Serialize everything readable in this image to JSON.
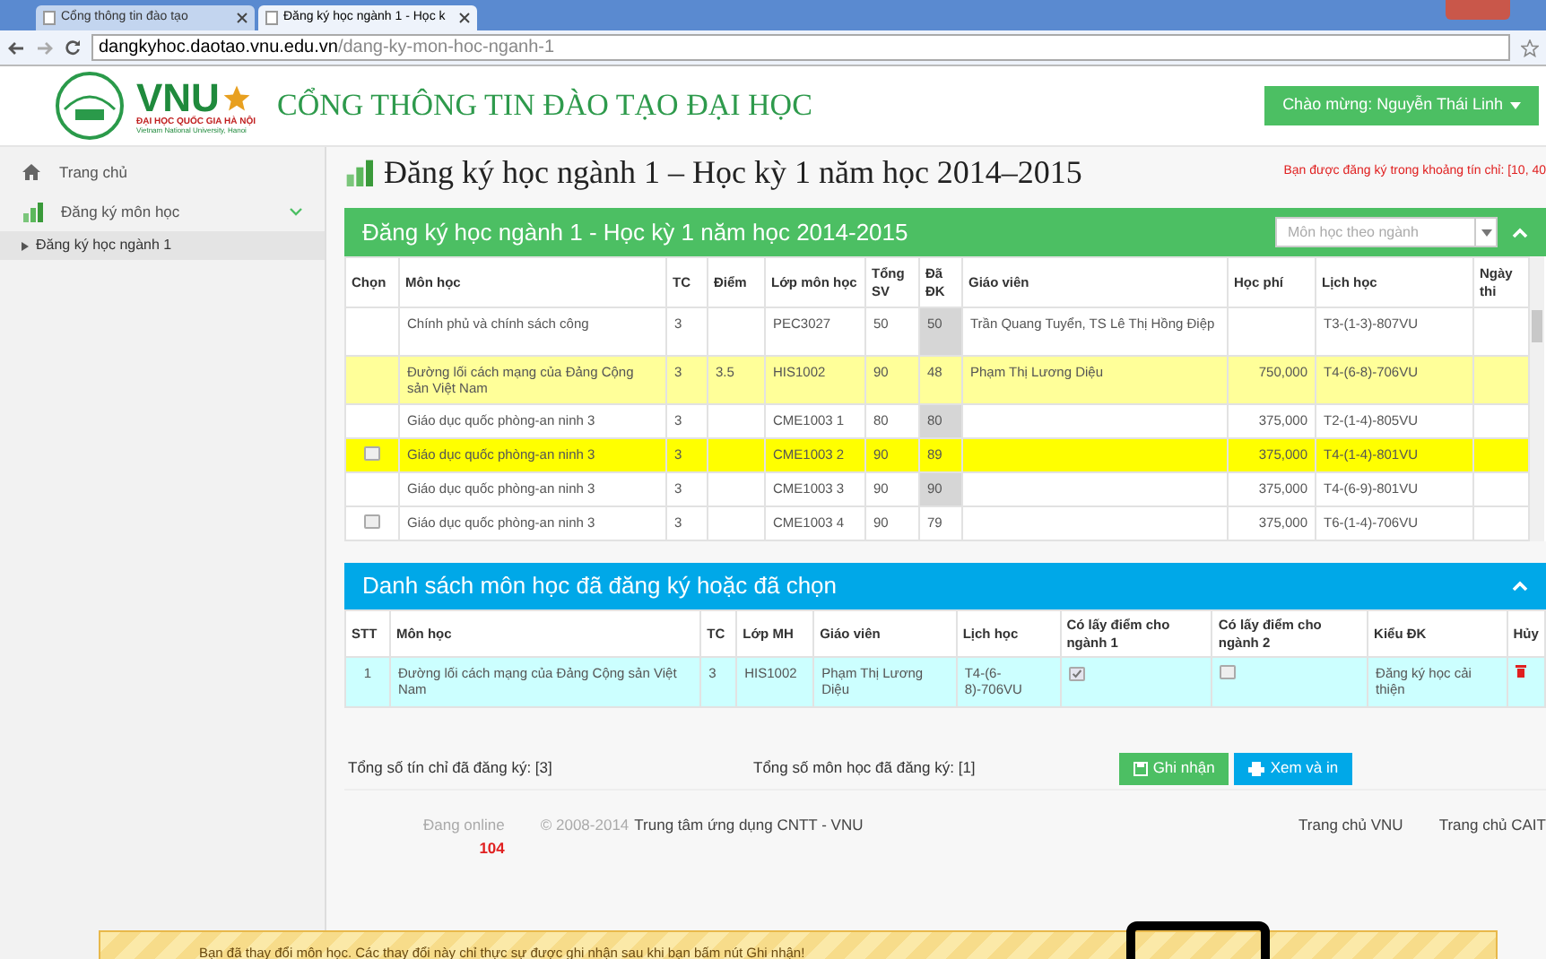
{
  "browser": {
    "tabs": [
      {
        "label": "Cổng thông tin đào tạo",
        "selected": false
      },
      {
        "label": "Đăng ký học ngành 1 - Học k",
        "selected": true
      }
    ],
    "url_host": "dangkyhoc.daotao.vnu.edu.vn",
    "url_path": "/dang-ky-mon-hoc-nganh-1"
  },
  "header": {
    "logo_text": "VNU",
    "logo_sub": "ĐẠI HỌC QUỐC GIA HÀ NỘI",
    "logo_sub2": "Vietnam National University, Hanoi",
    "site_title": "CỔNG THÔNG TIN ĐÀO TẠO ĐẠI HỌC",
    "welcome": "Chào mừng: Nguyễn Thái Linh"
  },
  "sidebar": {
    "items": [
      {
        "label": "Trang chủ",
        "selected": false
      },
      {
        "label": "Đăng ký môn học",
        "selected": false,
        "expanded": true,
        "children": [
          {
            "label": "Đăng ký học ngành 1",
            "selected": true
          }
        ]
      }
    ]
  },
  "page_title": "Đăng ký học ngành 1 – Học kỳ 1 năm học 2014–2015",
  "credit_note": "Bạn được đăng ký trong khoảng tín chỉ: [10, 40",
  "course_panel": {
    "title": "Đăng ký học ngành 1 - Học kỳ 1 năm học 2014-2015",
    "filter_placeholder": "Môn học theo ngành",
    "columns": [
      "Chọn",
      "Môn học",
      "TC",
      "Điểm",
      "Lớp môn học",
      "Tổng SV",
      "Đã ĐK",
      "Giáo viên",
      "Học phí",
      "Lịch học",
      "Ngày thi"
    ],
    "rows": [
      {
        "has_checkbox": false,
        "registered": false,
        "selected": false,
        "full": true,
        "cells": [
          "",
          "Chính phủ và chính sách công",
          "3",
          "",
          "PEC3027",
          "50",
          "50",
          "Trần Quang Tuyển, TS Lê Thị Hồng Điệp",
          "",
          "T3-(1-3)-807VU",
          ""
        ]
      },
      {
        "has_checkbox": false,
        "registered": true,
        "selected": false,
        "full": false,
        "cells": [
          "",
          "Đường lối cách mạng của Đảng Cộng sản Việt Nam",
          "3",
          "3.5",
          "HIS1002",
          "90",
          "48",
          "Phạm Thị Lương Diệu",
          "750,000",
          "T4-(6-8)-706VU",
          ""
        ]
      },
      {
        "has_checkbox": false,
        "registered": false,
        "selected": false,
        "full": true,
        "cells": [
          "",
          "Giáo dục quốc phòng-an ninh 3",
          "3",
          "",
          "CME1003 1",
          "80",
          "80",
          "",
          "375,000",
          "T2-(1-4)-805VU",
          ""
        ]
      },
      {
        "has_checkbox": true,
        "checked": false,
        "selected": true,
        "full": false,
        "cells": [
          "",
          "Giáo dục quốc phòng-an ninh 3",
          "3",
          "",
          "CME1003 2",
          "90",
          "89",
          "",
          "375,000",
          "T4-(1-4)-801VU",
          ""
        ]
      },
      {
        "has_checkbox": false,
        "registered": false,
        "selected": false,
        "full": true,
        "cells": [
          "",
          "Giáo dục quốc phòng-an ninh 3",
          "3",
          "",
          "CME1003 3",
          "90",
          "90",
          "",
          "375,000",
          "T4-(6-9)-801VU",
          ""
        ]
      },
      {
        "has_checkbox": true,
        "checked": false,
        "registered": false,
        "selected": false,
        "full": false,
        "cells": [
          "",
          "Giáo dục quốc phòng-an ninh 3",
          "3",
          "",
          "CME1003 4",
          "90",
          "79",
          "",
          "375,000",
          "T6-(1-4)-706VU",
          ""
        ]
      }
    ]
  },
  "chosen_panel": {
    "title": "Danh sách môn học đã đăng ký hoặc đã chọn",
    "columns": [
      "STT",
      "Môn học",
      "TC",
      "Lớp MH",
      "Giáo viên",
      "Lịch học",
      "Có lấy điểm cho ngành 1",
      "Có lấy điểm cho ngành 2",
      "Kiểu ĐK",
      "Hủy"
    ],
    "rows": [
      {
        "stt": "1",
        "course": "Đường lối cách mạng của Đảng Cộng sản Việt Nam",
        "tc": "3",
        "class": "HIS1002",
        "teacher": "Phạm Thị Lương Diệu",
        "schedule": "T4-(6-8)-706VU",
        "major1": true,
        "major2": false,
        "type": "Đăng ký học cải thiện"
      }
    ]
  },
  "totals": {
    "credits": "Tổng số tín chỉ đã đăng ký: [3]",
    "courses": "Tổng số môn học đã đăng ký: [1]"
  },
  "buttons": [
    {
      "label": "Ghi nhận",
      "kind": "save"
    },
    {
      "label": "Xem và in",
      "kind": "print"
    }
  ],
  "footer": {
    "online_label": "Đang online",
    "online_count": "104",
    "copyright": "© 2008-2014",
    "org": "Trung tâm ứng dụng CNTT - VNU",
    "links": [
      "Trang chủ VNU",
      "Trang chủ CAIT"
    ]
  },
  "notice": "Bạn đã thay đổi môn học. Các thay đổi này chỉ thực sự được ghi nhận sau khi bạn bấm nút Ghi nhận!"
}
